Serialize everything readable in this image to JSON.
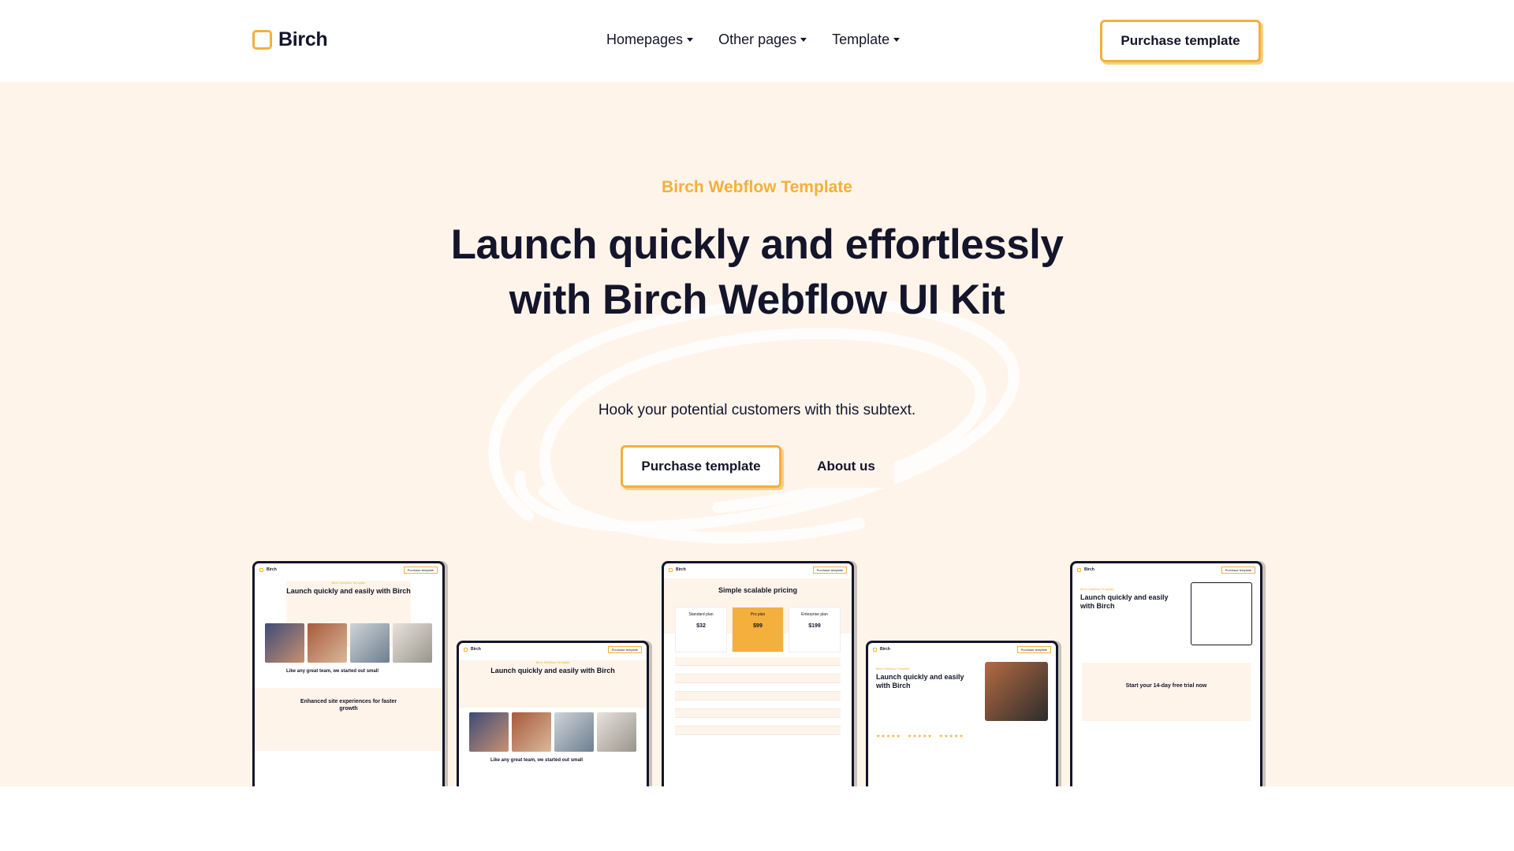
{
  "nav": {
    "brand": "Birch",
    "menu": [
      "Homepages",
      "Other pages",
      "Template"
    ],
    "cta": "Purchase template"
  },
  "hero": {
    "eyebrow": "Birch Webflow Template",
    "headline": "Launch quickly and effortlessly with Birch Webflow UI Kit",
    "subtext": "Hook your potential customers with this subtext.",
    "primary_cta": "Purchase template",
    "secondary_cta": "About us"
  },
  "previews": {
    "home_title": "Launch quickly and easily with Birch",
    "home_row_title": "Like any great team, we started out small",
    "home_section_title": "Enhanced site experiences for faster growth",
    "pricing_title": "Simple scalable pricing",
    "plans": [
      "Standard plan",
      "Pro plan",
      "Enterprise plan"
    ],
    "prices": [
      "$32",
      "$99",
      "$199"
    ],
    "signup_title": "Start your 14-day free trial now"
  },
  "colors": {
    "accent": "#f3b03d",
    "hero_bg": "#fff4ea",
    "text": "#14152b"
  }
}
